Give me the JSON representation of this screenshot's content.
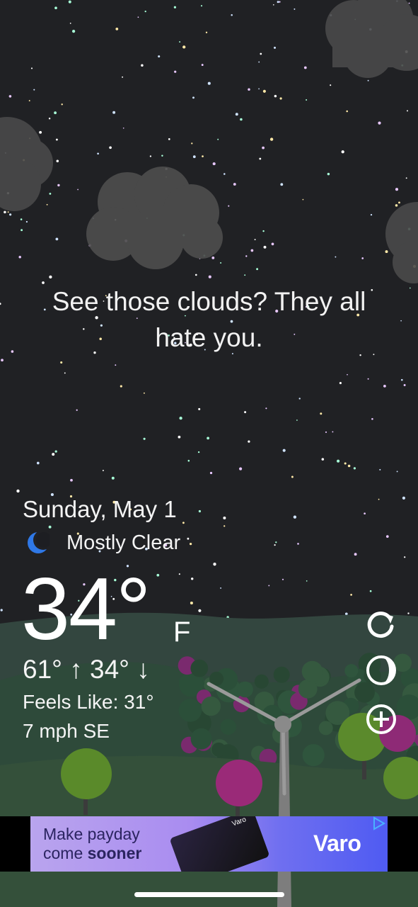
{
  "quote": {
    "line1": "See those clouds? They all",
    "line2": "hate you."
  },
  "weather": {
    "date": "Sunday, May 1",
    "condition": "Mostly Clear",
    "condition_icon": "crescent-moon-icon",
    "temperature": "34°",
    "unit": "F",
    "high_low": "61° ↑  34° ↓",
    "feels_like": "Feels Like: 31°",
    "wind": "7 mph SE"
  },
  "controls": {
    "refresh_icon": "refresh-icon",
    "moon_phase_icon": "moon-phase-icon",
    "add_icon": "add-location-icon"
  },
  "ad": {
    "line1": "Make payday",
    "line2_prefix": "come ",
    "line2_bold": "sooner",
    "brand": "Varo",
    "card_brand": "Varo"
  },
  "colors": {
    "sky": "#202124",
    "ad_accent": "#6f6ff0",
    "moon": "#2f78e6"
  }
}
